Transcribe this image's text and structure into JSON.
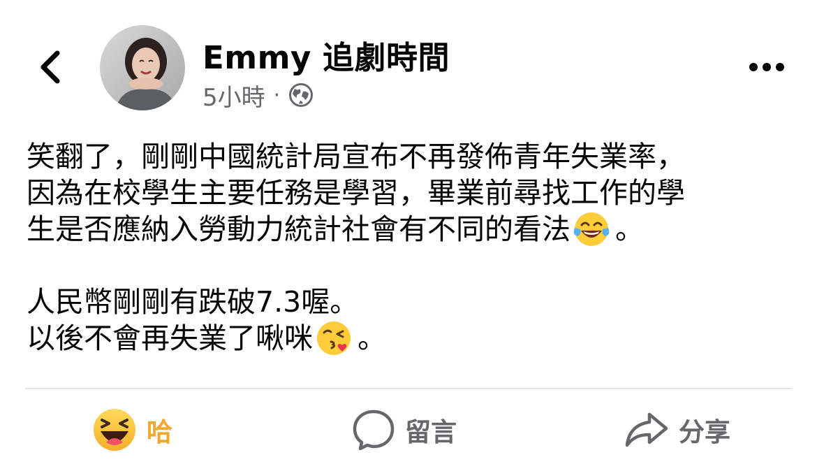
{
  "header": {
    "author_name": "Emmy 追劇時間",
    "timestamp": "5小時",
    "separator": "·",
    "audience_icon": "globe-icon",
    "back_icon": "chevron-left-icon",
    "more_icon": "ellipsis-icon"
  },
  "post": {
    "paragraph1": [
      "笑翻了，剛剛中國統計局宣布不再發佈青年失業率，",
      "因為在校學生主要任務是學習，畢業前尋找工作的學",
      "生是否應納入勞動力統計社會有不同的看法"
    ],
    "paragraph1_end": "。",
    "paragraph1_emoji": "tears-of-joy-emoji",
    "paragraph2_line1": "人民幣剛剛有跌破7.3喔。",
    "paragraph2_line2": "以後不會再失業了啾咪",
    "paragraph2_end": "。",
    "paragraph2_emoji": "kissing-heart-emoji"
  },
  "actions": {
    "react_label": "哈",
    "react_icon": "haha-reaction-icon",
    "comment_label": "留言",
    "comment_icon": "comment-bubble-icon",
    "share_label": "分享",
    "share_icon": "share-arrow-icon"
  },
  "colors": {
    "text_primary": "#050505",
    "text_secondary": "#65676b",
    "reaction_active": "#f0a72a",
    "divider": "#e4e6eb"
  }
}
